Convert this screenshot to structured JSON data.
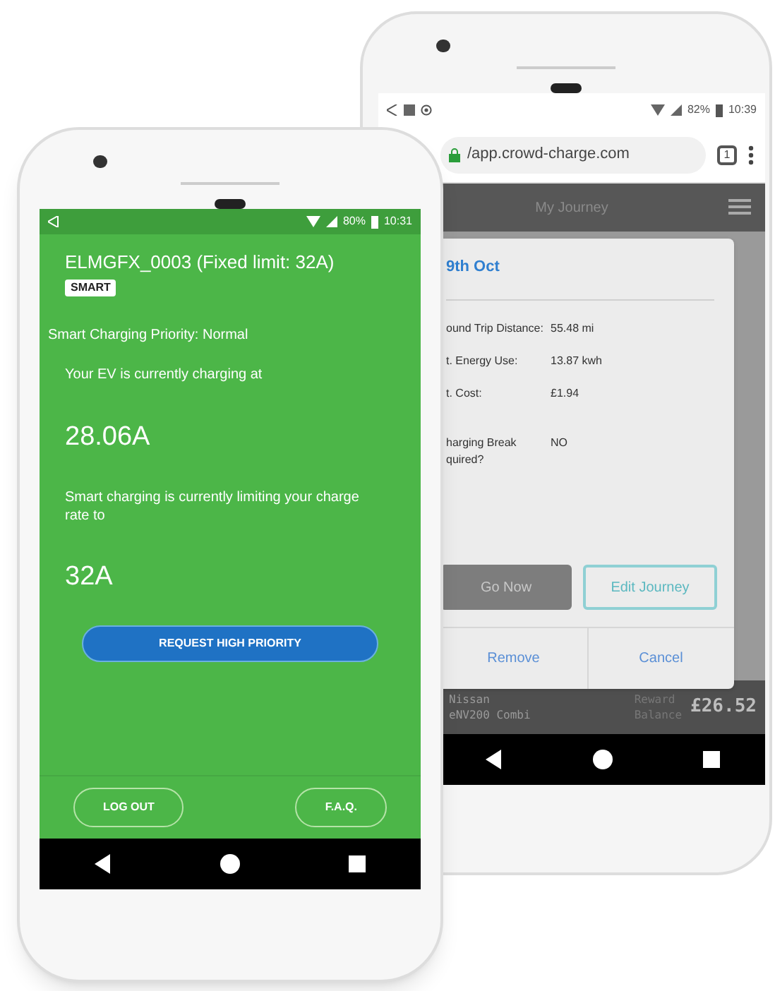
{
  "back_phone": {
    "status_bar": {
      "battery": "82%",
      "time": "10:39"
    },
    "browser": {
      "url": "/app.crowd-charge.com",
      "tab_count": "1"
    },
    "header": {
      "title": "My Journey"
    },
    "dialog": {
      "date": "9th Oct",
      "rows": [
        {
          "label_lines": [
            "ound Trip Distance:"
          ],
          "value": "55.48 mi"
        },
        {
          "label_lines": [
            "t. Energy Use:"
          ],
          "value": "13.87 kwh"
        },
        {
          "label_lines": [
            "t. Cost:"
          ],
          "value": "£1.94"
        },
        {
          "label_lines": [
            "harging Break",
            "quired?"
          ],
          "value": "NO"
        }
      ],
      "buttons": [
        {
          "label": "Go Now",
          "kind": "filled"
        },
        {
          "label": "Edit Journey",
          "kind": "outline"
        }
      ],
      "actions": [
        "Remove",
        "Cancel"
      ]
    },
    "vehicle": {
      "make": "Nissan",
      "model": "eNV200 Combi"
    },
    "reward": {
      "label_lines": [
        "Reward",
        "Balance"
      ],
      "amount": "£26.52"
    }
  },
  "front_phone": {
    "status_bar": {
      "battery": "80%",
      "time": "10:31"
    },
    "charger": {
      "title": "ELMGFX_0003 (Fixed limit: 32A)",
      "badge": "SMART"
    },
    "priority": "Smart Charging Priority: Normal",
    "current_label": "Your EV is currently charging at",
    "current_value": "28.06A",
    "limit_label": "Smart charging is currently limiting your charge rate to",
    "limit_value": "32A",
    "request_button": "REQUEST HIGH PRIORITY",
    "footer_buttons": [
      "LOG OUT",
      "F.A.Q."
    ]
  }
}
